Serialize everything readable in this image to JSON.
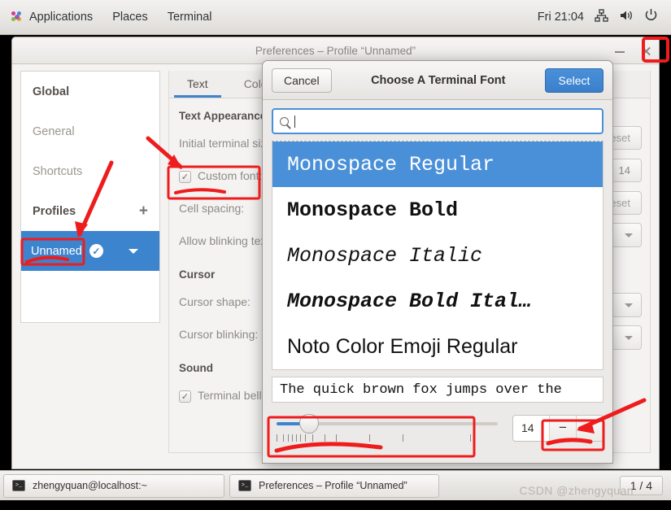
{
  "topbar": {
    "menus": [
      "Applications",
      "Places",
      "Terminal"
    ],
    "clock": "Fri 21:04",
    "icons": [
      "network-icon",
      "volume-icon",
      "power-icon"
    ]
  },
  "preferences_window": {
    "title": "Preferences – Profile “Unnamed”",
    "minimize_label": "",
    "close_label": "",
    "sidebar": {
      "global_label": "Global",
      "items": [
        "General",
        "Shortcuts"
      ],
      "profiles_label": "Profiles",
      "add_label": "+",
      "selected_profile": "Unnamed"
    },
    "tabs": [
      {
        "label": "Text",
        "active": true
      },
      {
        "label": "Colors",
        "active": false
      }
    ],
    "sections": [
      {
        "title": "Text Appearance",
        "rows": [
          {
            "label": "Initial terminal size:",
            "control": "reset",
            "control_label": "Reset"
          },
          {
            "label": "Custom font:",
            "control": "number",
            "control_label": "14",
            "checked": true
          },
          {
            "label": "Cell spacing:",
            "control": "reset",
            "control_label": "Reset"
          },
          {
            "label": "Allow blinking text:",
            "control": "combo",
            "control_label": ""
          }
        ]
      },
      {
        "title": "Cursor",
        "rows": [
          {
            "label": "Cursor shape:",
            "control": "combo",
            "control_label": ""
          },
          {
            "label": "Cursor blinking:",
            "control": "combo",
            "control_label": ""
          }
        ]
      },
      {
        "title": "Sound",
        "rows": [
          {
            "label": "Terminal bell",
            "control": "none",
            "control_label": "",
            "checked": true
          }
        ]
      }
    ]
  },
  "font_dialog": {
    "cancel_label": "Cancel",
    "title": "Choose A Terminal Font",
    "select_label": "Select",
    "search": {
      "value": "",
      "placeholder": "",
      "icon": "search-icon"
    },
    "fonts": [
      {
        "name": "Monospace Regular",
        "style": "mono-regular",
        "selected": true
      },
      {
        "name": "Monospace Bold",
        "style": "mono-bold",
        "selected": false
      },
      {
        "name": "Monospace Italic",
        "style": "mono-italic",
        "selected": false
      },
      {
        "name": "Monospace Bold Ital…",
        "style": "mono-bold-italic",
        "selected": false
      },
      {
        "name": "Noto Color Emoji Regular",
        "style": "sans-regular",
        "selected": false
      }
    ],
    "preview_text": "The quick brown fox jumps over the",
    "size_value": "14",
    "minus_label": "−",
    "plus_label": "+"
  },
  "taskbar": {
    "tasks": [
      {
        "label": "zhengyquan@localhost:~",
        "icon": "terminal-icon"
      },
      {
        "label": "Preferences – Profile “Unnamed”",
        "icon": "terminal-icon"
      }
    ],
    "pager": "1 / 4",
    "watermark": "CSDN @zhengyquan"
  },
  "annotations": {
    "color": "#ee1c1c",
    "boxes": [
      "close-button",
      "custom-font-row",
      "unnamed-profile",
      "size-slider",
      "spin-buttons"
    ],
    "arrows": [
      "to-custom-font",
      "to-unnamed-profile",
      "to-spin-buttons"
    ]
  },
  "colors": {
    "accent": "#3d84ce",
    "dialog_primary": "#4a90d9",
    "annotation_red": "#ee1c1c",
    "panel_bg": "#eceae8"
  }
}
